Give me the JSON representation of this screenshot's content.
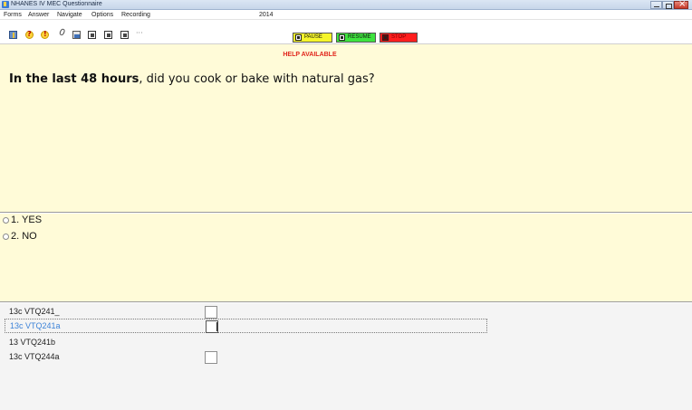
{
  "window": {
    "title": "NHANES IV MEC Questionnaire"
  },
  "menu": {
    "items": [
      "Forms",
      "Answer",
      "Navigate",
      "Options",
      "Recording"
    ],
    "year": "2014"
  },
  "toolbar": {
    "icons": [
      "question-book-icon",
      "help-question-icon",
      "alert-exclamation-icon",
      "attachment-icon",
      "document-icon",
      "box-icon-1",
      "box-icon-2",
      "box-icon-3",
      "more-icon"
    ],
    "more_label": "···",
    "pause_label": "PAUSE",
    "resume_label": "RESUME",
    "stop_label": "STOP",
    "colors": {
      "pause": "#f5f52a",
      "resume": "#3ee33e",
      "stop": "#ff1e1e"
    }
  },
  "question_panel": {
    "help_text": "HELP AVAILABLE",
    "question_bold": "In the last 48 hours",
    "question_rest": ", did you cook or bake with natural gas?",
    "background": "#fffbd8"
  },
  "answer_panel": {
    "options": [
      "1. YES",
      "2. NO"
    ]
  },
  "fields": {
    "rows": [
      {
        "label": "13c VTQ241_",
        "has_box": true
      },
      {
        "label": "13c VTQ241a",
        "has_box": true,
        "active": true
      },
      {
        "label": "13 VTQ241b",
        "has_box": false
      },
      {
        "label": "13c VTQ244a",
        "has_box": true
      }
    ]
  }
}
